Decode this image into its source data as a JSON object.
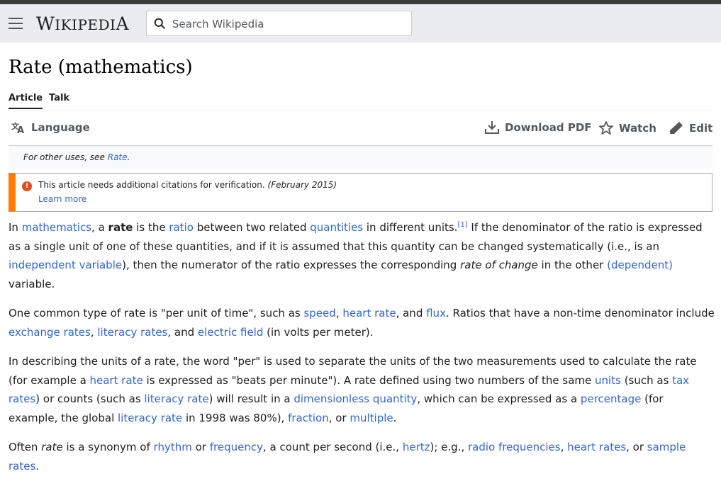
{
  "header": {
    "logo_word": "Wikipedia",
    "logo_first": "W",
    "logo_mid": "IKIPEDI",
    "logo_last": "A",
    "search_placeholder": "Search Wikipedia"
  },
  "page": {
    "title": "Rate (mathematics)",
    "tabs": [
      "Article",
      "Talk"
    ],
    "actions": {
      "language": "Language",
      "download": "Download PDF",
      "watch": "Watch",
      "edit": "Edit"
    },
    "hatnote_prefix": "For other uses, see ",
    "hatnote_link": "Rate",
    "hatnote_suffix": ".",
    "ambox_message": "This article needs additional citations for verification.",
    "ambox_date": "(February 2015)",
    "ambox_learn": "Learn more"
  },
  "paragraphs": [
    [
      {
        "t": "In "
      },
      {
        "t": "mathematics",
        "link": true
      },
      {
        "t": ", a "
      },
      {
        "t": "rate",
        "bold": true
      },
      {
        "t": " is the "
      },
      {
        "t": "ratio",
        "link": true
      },
      {
        "t": " between two related "
      },
      {
        "t": "quantities",
        "link": true
      },
      {
        "t": " in different units."
      },
      {
        "t": "[1]",
        "sup": true,
        "link": true
      },
      {
        "t": " If the denominator of the ratio is expressed as a single unit of one of these quantities, and if it is assumed that this quantity can be changed systematically (i.e., is an "
      },
      {
        "t": "independent variable",
        "link": true
      },
      {
        "t": "), then the numerator of the ratio expresses the corresponding "
      },
      {
        "t": "rate of change",
        "italic": true
      },
      {
        "t": " in the other "
      },
      {
        "t": "(dependent)",
        "link": true
      },
      {
        "t": " variable."
      }
    ],
    [
      {
        "t": "One common type of rate is \"per unit of time\", such as "
      },
      {
        "t": "speed",
        "link": true
      },
      {
        "t": ", "
      },
      {
        "t": "heart rate",
        "link": true
      },
      {
        "t": ", and "
      },
      {
        "t": "flux",
        "link": true
      },
      {
        "t": ". Ratios that have a non-time denominator include "
      },
      {
        "t": "exchange rates",
        "link": true
      },
      {
        "t": ", "
      },
      {
        "t": "literacy rates",
        "link": true
      },
      {
        "t": ", and "
      },
      {
        "t": "electric field",
        "link": true
      },
      {
        "t": " (in volts per meter)."
      }
    ],
    [
      {
        "t": "In describing the units of a rate, the word \"per\" is used to separate the units of the two measurements used to calculate the rate (for example a "
      },
      {
        "t": "heart rate",
        "link": true
      },
      {
        "t": " is expressed as \"beats per minute\"). A rate defined using two numbers of the same "
      },
      {
        "t": "units",
        "link": true
      },
      {
        "t": " (such as "
      },
      {
        "t": "tax rates",
        "link": true
      },
      {
        "t": ") or counts (such as "
      },
      {
        "t": "literacy rate",
        "link": true
      },
      {
        "t": ") will result in a "
      },
      {
        "t": "dimensionless quantity",
        "link": true
      },
      {
        "t": ", which can be expressed as a "
      },
      {
        "t": "percentage",
        "link": true
      },
      {
        "t": " (for example, the global "
      },
      {
        "t": "literacy rate",
        "link": true
      },
      {
        "t": " in 1998 was 80%), "
      },
      {
        "t": "fraction",
        "link": true
      },
      {
        "t": ", or "
      },
      {
        "t": "multiple",
        "link": true
      },
      {
        "t": "."
      }
    ],
    [
      {
        "t": "Often "
      },
      {
        "t": "rate",
        "italic": true
      },
      {
        "t": " is a synonym of "
      },
      {
        "t": "rhythm",
        "link": true
      },
      {
        "t": " or "
      },
      {
        "t": "frequency",
        "link": true
      },
      {
        "t": ", a count per second (i.e., "
      },
      {
        "t": "hertz",
        "link": true
      },
      {
        "t": "); e.g., "
      },
      {
        "t": "radio frequencies",
        "link": true
      },
      {
        "t": ", "
      },
      {
        "t": "heart rates",
        "link": true
      },
      {
        "t": ", or "
      },
      {
        "t": "sample rates",
        "link": true
      },
      {
        "t": "."
      }
    ]
  ],
  "colors": {
    "link": "#3366cc",
    "warning": "#ff7c00",
    "header_bg": "#eaecf0"
  },
  "icons": [
    "menu-icon",
    "search-icon",
    "language-icon",
    "download-icon",
    "star-icon",
    "pencil-icon",
    "warning-icon"
  ]
}
